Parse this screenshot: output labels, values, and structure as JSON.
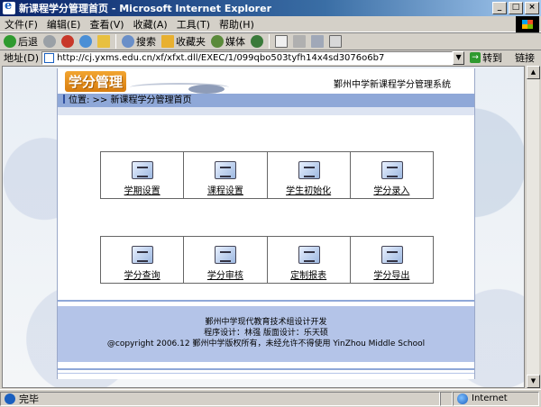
{
  "window": {
    "title": "新课程学分管理首页 - Microsoft Internet Explorer",
    "controls": [
      "_",
      "□",
      "×"
    ]
  },
  "menu": [
    "文件(F)",
    "编辑(E)",
    "查看(V)",
    "收藏(A)",
    "工具(T)",
    "帮助(H)"
  ],
  "toolbar": {
    "back": "后退",
    "search": "搜索",
    "favorites": "收藏夹",
    "media": "媒体"
  },
  "address": {
    "label": "地址(D)",
    "url": "http://cj.yxms.edu.cn/xf/xfxt.dll/EXEC/1/099qbo503tyfh14x4sd3076o6b7",
    "go": "转到",
    "links": "链接"
  },
  "page": {
    "logo": "学分管理",
    "system_title": "鄞州中学新课程学分管理系统",
    "breadcrumb": "位置: >> 新课程学分管理首页",
    "row1": [
      {
        "label": "学期设置",
        "icon": "calendar-icon"
      },
      {
        "label": "课程设置",
        "icon": "course-icon"
      },
      {
        "label": "学生初始化",
        "icon": "student-icon"
      },
      {
        "label": "学分录入",
        "icon": "pen-entry-icon"
      }
    ],
    "row2": [
      {
        "label": "学分查询",
        "icon": "magnifier-icon"
      },
      {
        "label": "学分审核",
        "icon": "review-icon"
      },
      {
        "label": "定制报表",
        "icon": "report-icon"
      },
      {
        "label": "学分导出",
        "icon": "export-icon"
      }
    ],
    "footer": {
      "line1": "鄞州中学现代教育技术组设计开发",
      "line2": "程序设计：林强  版面设计：乐天硕",
      "line3": "@copyright 2006.12 鄞州中学版权所有，未经允许不得使用 YinZhou Middle School"
    }
  },
  "status": {
    "text": "完毕",
    "zone": "Internet"
  },
  "colors": {
    "titlebar": "#0a246a",
    "banner_bar": "#8fa8d8",
    "footer_bg": "#b4c4e8"
  }
}
